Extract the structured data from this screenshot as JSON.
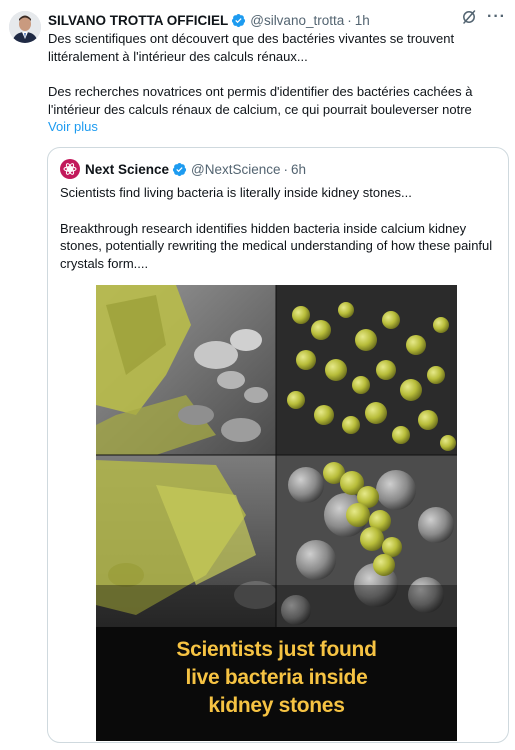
{
  "tweet": {
    "author_name": "SILVANO TROTTA OFFICIEL",
    "handle": "@silvano_trotta",
    "separator": "·",
    "time": "1h",
    "paragraph_1": "Des scientifiques ont découvert que des bactéries vivantes se trouvent littéralement à l'intérieur des calculs rénaux...",
    "paragraph_2": "Des recherches novatrices ont permis d'identifier des bactéries cachées à l'intérieur des calculs rénaux de calcium, ce qui pourrait bouleverser notre",
    "show_more": "Voir plus",
    "more_label": "···"
  },
  "quote": {
    "author_name": "Next Science",
    "handle": "@NextScience",
    "separator": "·",
    "time": "6h",
    "paragraph_1": "Scientists find living bacteria is literally inside kidney stones...",
    "paragraph_2": "Breakthrough research identifies hidden bacteria inside calcium kidney stones, potentially rewriting the medical understanding of how these painful crystals form....",
    "media": {
      "caption_line_1": "Scientists just found",
      "caption_line_2": "live bacteria inside",
      "caption_line_3": "kidney stones"
    }
  },
  "colors": {
    "link": "#1d9bf0",
    "verified": "#1d9bf0",
    "secondary_text": "#536471",
    "caption": "#f6c343",
    "quote_avatar": "#c2185b"
  },
  "icons": {
    "verified": "verified-badge-icon",
    "grok": "grok-icon",
    "more": "more-icon"
  }
}
